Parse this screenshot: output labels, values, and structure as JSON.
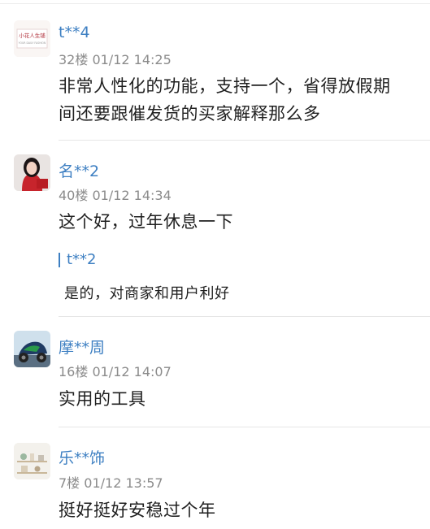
{
  "comments": [
    {
      "user": "t**4",
      "meta": "32楼 01/12 14:25",
      "text": "非常人性化的功能，支持一个，省得放假期间还要跟催发货的买家解释那么多",
      "avatar_icon": "brand-logo-icon",
      "avatar_text_1": "小花人生铺",
      "avatar_text_2": "YOUR DAILY FASHION"
    },
    {
      "user": "名**2",
      "meta": "40楼 01/12 14:34",
      "text": "这个好，过年休息一下",
      "avatar_icon": "woman-portrait-icon",
      "reply": {
        "user": "t**2",
        "text": "是的，对商家和用户利好"
      }
    },
    {
      "user": "摩**周",
      "meta": "16楼 01/12 14:07",
      "text": "实用的工具",
      "avatar_icon": "motorcycle-icon"
    },
    {
      "user": "乐**饰",
      "meta": "7楼 01/12 13:57",
      "text": "挺好挺好安稳过个年",
      "avatar_icon": "shelf-decor-icon"
    }
  ],
  "colors": {
    "username": "#3d7fc2",
    "meta": "#8b8b8b",
    "body_text": "#1f1f1f",
    "divider": "#e6e6e6"
  }
}
